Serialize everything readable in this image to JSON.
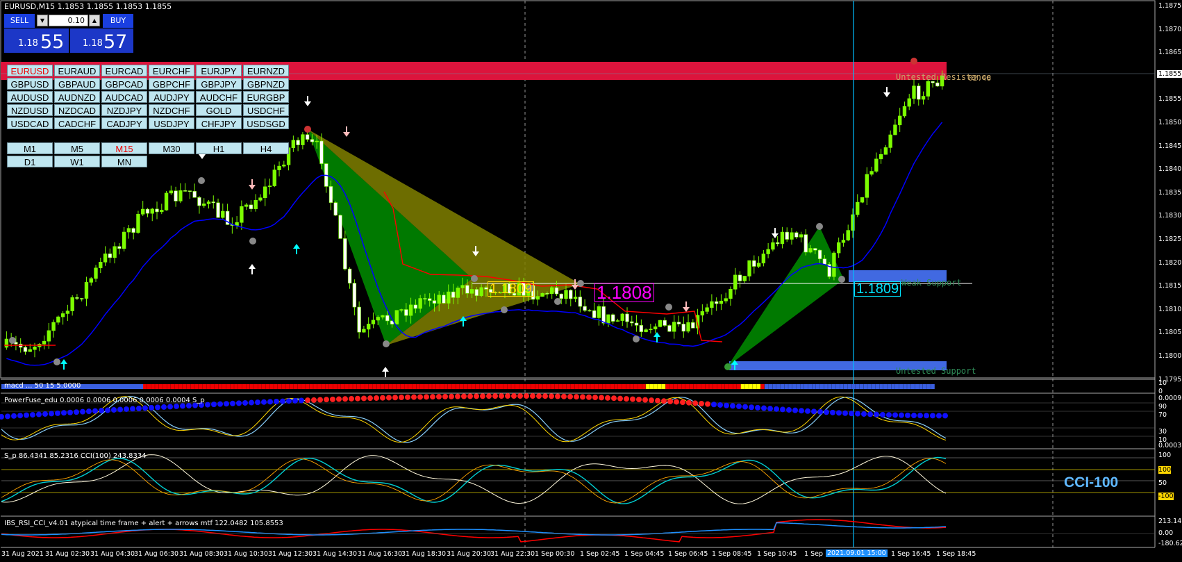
{
  "window": {
    "title": "EURUSD,M15  1.1853 1.1855 1.1853 1.1855"
  },
  "trade_panel": {
    "sell_label": "SELL",
    "buy_label": "BUY",
    "lot_value": "0.10",
    "sell_price_small": "1.18",
    "sell_price_big": "55",
    "buy_price_small": "1.18",
    "buy_price_big": "57"
  },
  "symbols": [
    [
      "EURUSD",
      "EURAUD",
      "EURCAD",
      "EURCHF",
      "EURJPY",
      "EURNZD"
    ],
    [
      "GBPUSD",
      "GBPAUD",
      "GBPCAD",
      "GBPCHF",
      "GBPJPY",
      "GBPNZD"
    ],
    [
      "AUDUSD",
      "AUDNZD",
      "AUDCAD",
      "AUDJPY",
      "AUDCHF",
      "EURGBP"
    ],
    [
      "NZDUSD",
      "NZDCAD",
      "NZDJPY",
      "NZDCHF",
      "GOLD",
      "USDCHF"
    ],
    [
      "USDCAD",
      "CADCHF",
      "CADJPY",
      "USDJPY",
      "CHFJPY",
      "USDSGD"
    ]
  ],
  "active_symbol": "EURUSD",
  "timeframes": [
    "M1",
    "M5",
    "M15",
    "M30",
    "H1",
    "H4",
    "D1",
    "W1",
    "MN"
  ],
  "active_timeframe": "M15",
  "main_price_axis": [
    "1.1875",
    "1.1870",
    "1.1865",
    "1.1860",
    "1.1855",
    "1.1850",
    "1.1845",
    "1.1840",
    "1.1835",
    "1.1830",
    "1.1825",
    "1.1820",
    "1.1815",
    "1.1810",
    "1.1805",
    "1.1800",
    "1.1795"
  ],
  "current_price": "1.1855",
  "levels": {
    "resistance_label": "Untested Resistance",
    "resistance_value": "02.46",
    "weak_support_label": "Weak Support",
    "support_label": "Untested Support"
  },
  "price_tags": {
    "fib_1": "1.1809",
    "fib_2": "1.1808",
    "fib_3": "1.1809"
  },
  "indicators": {
    "strip_label": "macd  ...  50 15 5.0000",
    "strip_axis_top": "10",
    "strip_axis_bottom": "0",
    "powerfuse_label": "PowerFuse_edu 0.0006 0.0006 0.0006 0.0006 0.0004 S_p",
    "powerfuse_axis": [
      "0.0009",
      "90",
      "70",
      "30",
      "10",
      "0.0003"
    ],
    "cci_label": "S_p 86.4341 85.2316  CCI(100) 243.8334",
    "cci_axis": [
      "100",
      "100",
      "50",
      "-100",
      "-100"
    ],
    "cci_big": "CCI-100",
    "ibs_label": "IBS_RSI_CCI_v4.01 atypical time frame + alert + arrows mtf 122.0482 105.8553",
    "ibs_axis": [
      "213.1459",
      "0.00",
      "-180.622"
    ]
  },
  "time_axis": [
    "31 Aug 2021",
    "31 Aug 02:30",
    "31 Aug 04:30",
    "31 Aug 06:30",
    "31 Aug 08:30",
    "31 Aug 10:30",
    "31 Aug 12:30",
    "31 Aug 14:30",
    "31 Aug 16:30",
    "31 Aug 18:30",
    "31 Aug 20:30",
    "31 Aug 22:30",
    "1 Sep 00:30",
    "1 Sep 02:45",
    "1 Sep 04:45",
    "1 Sep 06:45",
    "1 Sep 08:45",
    "1 Sep 10:45",
    "1 Sep 1",
    "1 Sep 16:45",
    "1 Sep 18:45"
  ],
  "crosshair_time": "2021.09.01 15:00",
  "colors": {
    "resistance": "#dc143c",
    "support": "#4169e1",
    "bull": "#7cfc00",
    "bear": "#ffffff",
    "ma_blue": "#0000ff",
    "ma_red": "#ff0000",
    "harmonic_green": "#008000",
    "harmonic_olive": "#808000",
    "crosshair": "#00bfff"
  }
}
